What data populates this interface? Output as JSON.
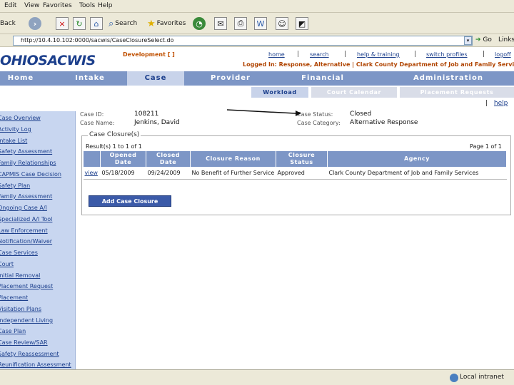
{
  "browser": {
    "menu": [
      "Edit",
      "View",
      "Favorites",
      "Tools",
      "Help"
    ],
    "toolbar": {
      "back_label": "Back",
      "search_label": "Search",
      "favorites_label": "Favorites"
    },
    "address": "http://10.4.10.102:0000/sacwis/CaseClosureSelect.do",
    "go_label": "Go",
    "links_label": "Links",
    "status": "Local intranet"
  },
  "app": {
    "logo": "OHIOSACWIS",
    "dev_tag": "Development [ ]",
    "top_links": [
      "home",
      "search",
      "help & training",
      "switch profiles",
      "logoff"
    ],
    "logged_in_label": "Logged In:",
    "logged_in_value": "Response, Alternative | Clark County Department of Job and Family Services |",
    "nav_tabs": [
      "Home",
      "Intake",
      "Case",
      "Provider",
      "Financial",
      "Administration"
    ],
    "sub_tabs": [
      "Workload",
      "Court Calendar",
      "Placement Requests"
    ],
    "help_link": "help"
  },
  "sidebar": {
    "items": [
      "Case Overview",
      "Activity Log",
      "Intake List",
      "Safety Assessment",
      "Family Relationships",
      "CAPMIS Case Decision",
      "Safety Plan",
      "Family Assessment",
      "Ongoing Case A/I",
      "Specialized A/I Tool",
      "Law Enforcement",
      "Notification/Waiver",
      "Case Services",
      "Court",
      "Initial Removal",
      "Placement Request",
      "Placement",
      "Visitation Plans",
      "Independent Living",
      "Case Plan",
      "Case Review/SAR",
      "Safety Reassessment",
      "Reunification Assessment"
    ]
  },
  "case": {
    "id_label": "Case ID:",
    "id_value": "108211",
    "name_label": "Case Name:",
    "name_value": "Jenkins, David",
    "status_label": "Case Status:",
    "status_value": "Closed",
    "category_label": "Case Category:",
    "category_value": "Alternative Response"
  },
  "closures": {
    "legend": "Case Closure(s)",
    "results": "Result(s) 1 to 1 of 1",
    "page": "Page 1 of 1",
    "columns": [
      "",
      "Opened Date",
      "Closed Date",
      "Closure Reason",
      "Closure Status",
      "Agency"
    ],
    "rows": [
      {
        "action": "view",
        "opened": "05/18/2009",
        "closed": "09/24/2009",
        "reason": "No Benefit of Further Service",
        "status": "Approved",
        "agency": "Clark County Department of Job and Family Services"
      }
    ],
    "add_button": "Add Case Closure"
  },
  "colors": {
    "nav_bg": "#7d96c6",
    "nav_active": "#c8d3ea",
    "sidebar_bg": "#c8d6f0",
    "brand": "#1c3f8c",
    "accent": "#c05000"
  }
}
